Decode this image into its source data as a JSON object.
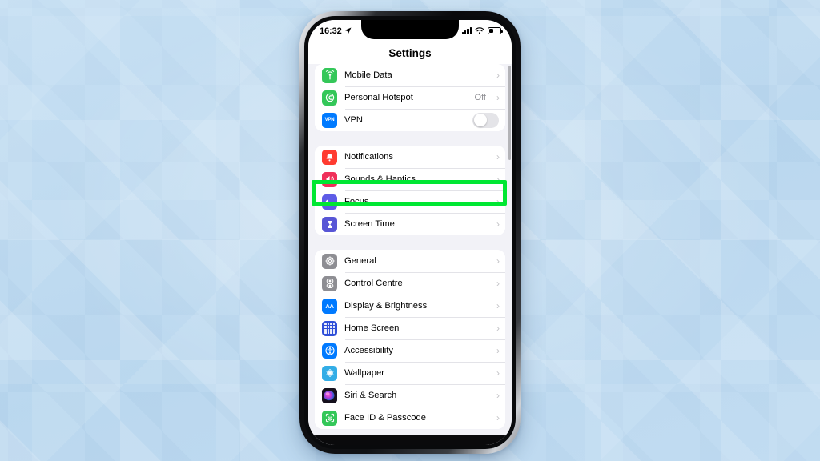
{
  "background": {
    "name": "light-blue-geometric-pattern",
    "base_color": "#bfdaf0"
  },
  "phone": {
    "frame_color": "#0a0a0c",
    "screen_bg": "#f2f2f7"
  },
  "status_bar": {
    "time": "16:32",
    "location_icon": "location-arrow-icon",
    "signal_icon": "cellular-signal-icon",
    "wifi_icon": "wifi-icon",
    "battery_icon": "battery-icon"
  },
  "nav": {
    "title": "Settings"
  },
  "highlight": {
    "target_label": "Sounds & Haptics",
    "color": "#00e732",
    "border_width_px": 5
  },
  "groups": [
    {
      "name": "connectivity-group",
      "rows": [
        {
          "label": "Mobile Data",
          "icon": "cellular-antenna-icon",
          "icon_color": "#34c759",
          "glyph": "((·))",
          "accessory": "chevron",
          "value": ""
        },
        {
          "label": "Personal Hotspot",
          "icon": "hotspot-icon",
          "icon_color": "#34c759",
          "glyph": "⚇",
          "accessory": "chevron",
          "value": "Off"
        },
        {
          "label": "VPN",
          "icon": "vpn-icon",
          "icon_color": "#007aff",
          "glyph": "VPN",
          "accessory": "toggle",
          "toggle_on": false,
          "value": ""
        }
      ]
    },
    {
      "name": "notifications-group",
      "rows": [
        {
          "label": "Notifications",
          "icon": "bell-icon",
          "icon_color": "#ff3b30",
          "glyph": "🔔",
          "accessory": "chevron",
          "value": ""
        },
        {
          "label": "Sounds & Haptics",
          "icon": "speaker-icon",
          "icon_color": "#f0305a",
          "glyph": "🔊",
          "accessory": "chevron",
          "value": "",
          "highlighted": true
        },
        {
          "label": "Focus",
          "icon": "moon-icon",
          "icon_color": "#5e5ce6",
          "glyph": "☾",
          "accessory": "chevron",
          "value": ""
        },
        {
          "label": "Screen Time",
          "icon": "hourglass-icon",
          "icon_color": "#5856d6",
          "glyph": "⌛",
          "accessory": "chevron",
          "value": ""
        }
      ]
    },
    {
      "name": "system-group",
      "rows": [
        {
          "label": "General",
          "icon": "gear-icon",
          "icon_color": "#8e8e93",
          "glyph": "⚙",
          "accessory": "chevron",
          "value": ""
        },
        {
          "label": "Control Centre",
          "icon": "control-centre-icon",
          "icon_color": "#8e8e93",
          "glyph": "☰",
          "accessory": "chevron",
          "value": ""
        },
        {
          "label": "Display & Brightness",
          "icon": "display-brightness-icon",
          "icon_color": "#007aff",
          "glyph": "AA",
          "accessory": "chevron",
          "value": ""
        },
        {
          "label": "Home Screen",
          "icon": "home-screen-grid-icon",
          "icon_color": "#2f4fd8",
          "glyph": "grid",
          "accessory": "chevron",
          "value": ""
        },
        {
          "label": "Accessibility",
          "icon": "accessibility-icon",
          "icon_color": "#007aff",
          "glyph": "⛹",
          "accessory": "chevron",
          "value": ""
        },
        {
          "label": "Wallpaper",
          "icon": "wallpaper-flower-icon",
          "icon_color": "#32ade6",
          "glyph": "✿",
          "accessory": "chevron",
          "value": ""
        },
        {
          "label": "Siri & Search",
          "icon": "siri-icon",
          "icon_color": "#2b2038",
          "glyph": "",
          "accessory": "chevron",
          "value": ""
        },
        {
          "label": "Face ID & Passcode",
          "icon": "face-id-icon",
          "icon_color": "#34c759",
          "glyph": "☺",
          "accessory": "chevron",
          "value": "",
          "clipped": true
        }
      ]
    }
  ],
  "chevron_glyph": "›"
}
